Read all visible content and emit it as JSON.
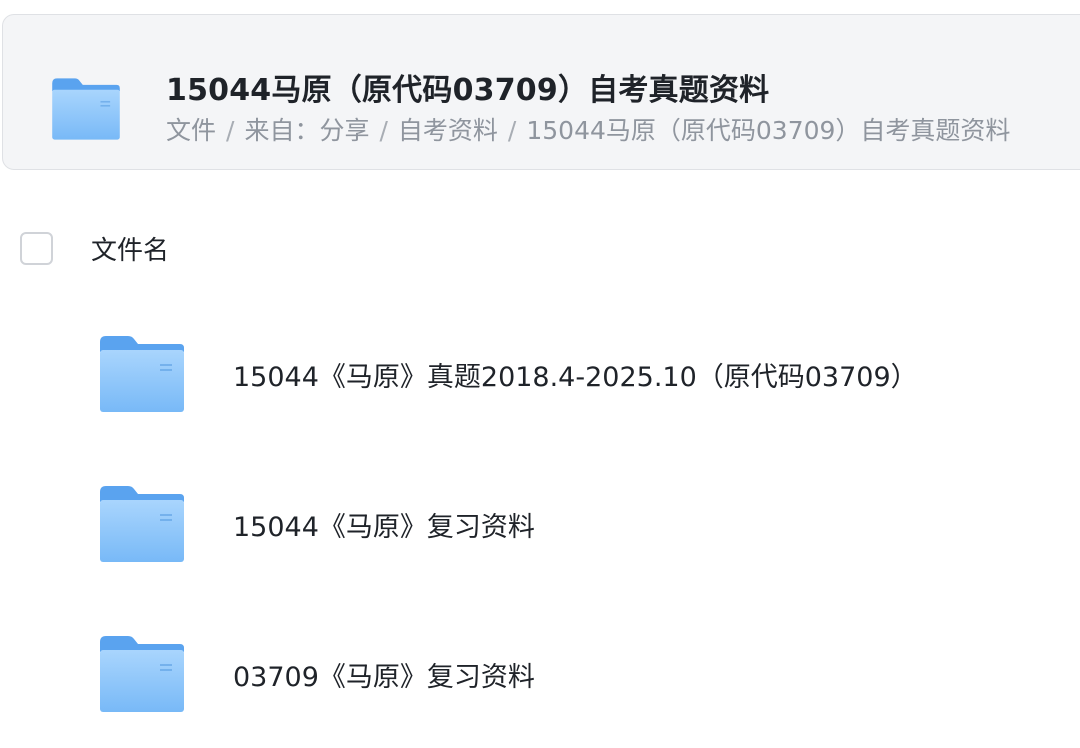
{
  "header": {
    "icon": "folder-icon",
    "title": "15044马原（原代码03709）自考真题资料",
    "breadcrumb": {
      "items": [
        "文件",
        "来自：分享",
        "自考资料",
        "15044马原（原代码03709）自考真题资料"
      ],
      "separator": "/"
    }
  },
  "list": {
    "column_label": "文件名",
    "files": [
      {
        "name": "15044《马原》真题2018.4-2025.10（原代码03709）",
        "icon": "folder-icon"
      },
      {
        "name": "15044《马原》复习资料",
        "icon": "folder-icon"
      },
      {
        "name": "03709《马原》复习资料",
        "icon": "folder-icon"
      }
    ]
  },
  "colors": {
    "folder_light": "#8cc6fb",
    "folder_dark": "#5aa3ef",
    "header_bg": "#f4f5f7",
    "muted_text": "#8f959e"
  }
}
